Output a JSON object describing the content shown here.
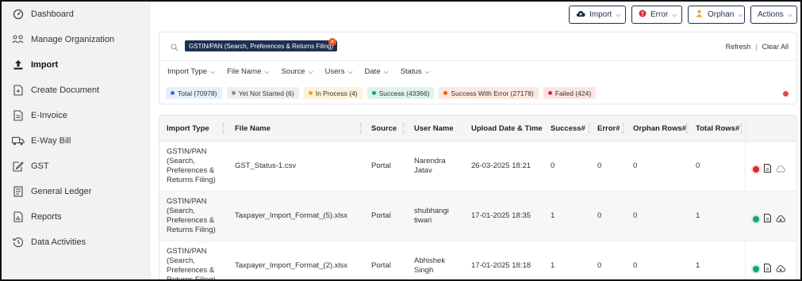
{
  "sidebar": {
    "items": [
      {
        "label": "Dashboard",
        "icon": "dashboard-icon"
      },
      {
        "label": "Manage Organization",
        "icon": "organization-icon"
      },
      {
        "label": "Import",
        "icon": "upload-icon"
      },
      {
        "label": "Create Document",
        "icon": "document-plus-icon"
      },
      {
        "label": "E-Invoice",
        "icon": "invoice-icon"
      },
      {
        "label": "E-Way Bill",
        "icon": "truck-icon"
      },
      {
        "label": "GST",
        "icon": "edit-icon"
      },
      {
        "label": "General Ledger",
        "icon": "ledger-icon"
      },
      {
        "label": "Reports",
        "icon": "report-icon"
      },
      {
        "label": "Data Activities",
        "icon": "history-icon"
      }
    ]
  },
  "toolbar": {
    "import_label": "Import",
    "error_label": "Error",
    "orphan_label": "Orphan",
    "actions_label": "Actions"
  },
  "search": {
    "chip_label": "GSTIN/PAN (Search, Preferences & Returns Filing)",
    "refresh_label": "Refresh",
    "separator": "|",
    "clear_label": "Clear All"
  },
  "filters": [
    "Import Type",
    "File Name",
    "Source",
    "Users",
    "Date",
    "Status"
  ],
  "status_pills": [
    {
      "label": "Total (70978)",
      "bg": "#e6f0fb",
      "dot": "#2f7ad1"
    },
    {
      "label": "Yet Not Started (6)",
      "bg": "#eeeff1",
      "dot": "#8c9096"
    },
    {
      "label": "In Process (4)",
      "bg": "#fdf2dc",
      "dot": "#f0a21c"
    },
    {
      "label": "Success (43366)",
      "bg": "#ddf3ec",
      "dot": "#1aa37a"
    },
    {
      "label": "Success With Error (27178)",
      "bg": "#fde8df",
      "dot": "#e85a1a"
    },
    {
      "label": "Failed (424)",
      "bg": "#fde4e4",
      "dot": "#d92c2c"
    }
  ],
  "table": {
    "headers": [
      "Import Type",
      "File Name",
      "Source",
      "User Name",
      "Upload Date & Time",
      "Success#",
      "Error#",
      "Orphan Rows#",
      "Total Rows#"
    ],
    "rows": [
      {
        "import_type": "GSTIN/PAN (Search, Preferences & Returns Filing)",
        "file_name": "GST_Status-1.csv",
        "source": "Portal",
        "user": "Narendra Jatav",
        "date": "26-03-2025 18:21",
        "success": "0",
        "error": "0",
        "orphan": "0",
        "total": "0",
        "status_color": "#e2262f"
      },
      {
        "import_type": "GSTIN/PAN (Search, Preferences & Returns Filing)",
        "file_name": "Taxpayer_Import_Format_(5).xlsx",
        "source": "Portal",
        "user": "shubhangi tiwari",
        "date": "17-01-2025 18:35",
        "success": "1",
        "error": "0",
        "orphan": "0",
        "total": "1",
        "status_color": "#1aa37a"
      },
      {
        "import_type": "GSTIN/PAN (Search, Preferences & Returns Filing)",
        "file_name": "Taxpayer_Import_Format_(2).xlsx",
        "source": "Portal",
        "user": "Abhishek Singh",
        "date": "17-01-2025 18:18",
        "success": "1",
        "error": "0",
        "orphan": "0",
        "total": "1",
        "status_color": "#1aa37a"
      }
    ]
  }
}
